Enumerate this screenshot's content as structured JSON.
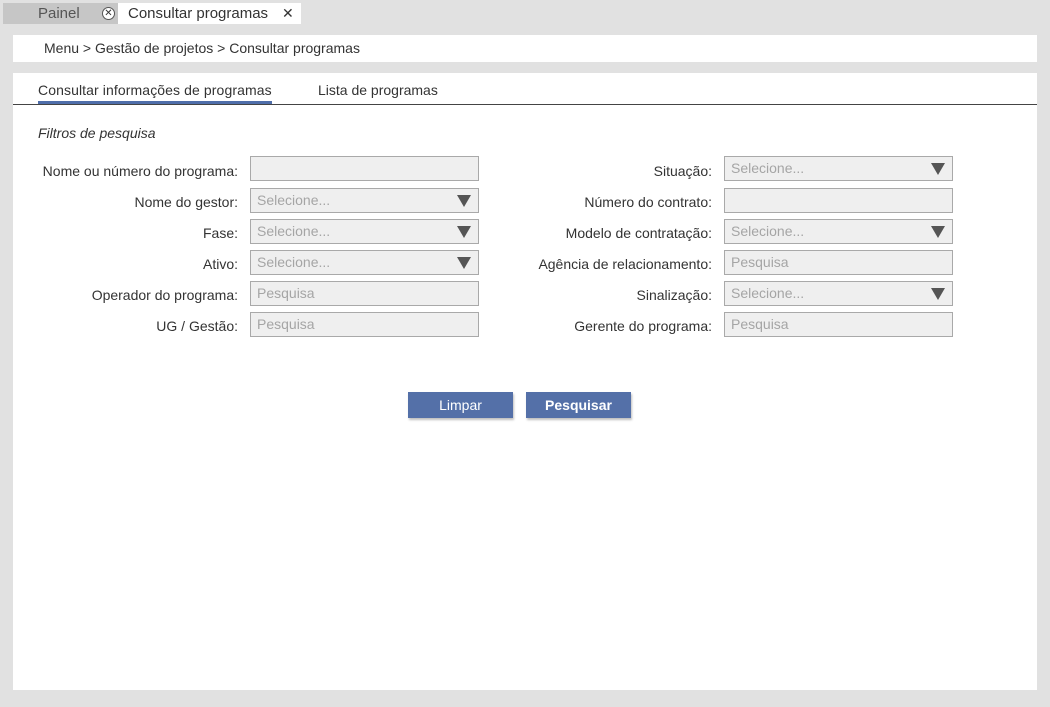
{
  "tabs": [
    {
      "label": "Painel"
    },
    {
      "label": "Consultar programas"
    }
  ],
  "breadcrumb": "Menu > Gestão de projetos > Consultar programas",
  "panel_tabs": {
    "active": "Consultar informações de programas",
    "list": "Lista de programas"
  },
  "section_title": "Filtros de pesquisa",
  "left_fields": [
    {
      "label": "Nome ou número do programa:",
      "value": "",
      "type": "text"
    },
    {
      "label": "Nome do gestor:",
      "value": "Selecione...",
      "type": "select"
    },
    {
      "label": "Fase:",
      "value": "Selecione...",
      "type": "select"
    },
    {
      "label": "Ativo:",
      "value": "Selecione...",
      "type": "select"
    },
    {
      "label": "Operador do programa:",
      "value": "Pesquisa",
      "type": "text"
    },
    {
      "label": "UG / Gestão:",
      "value": "Pesquisa",
      "type": "text"
    }
  ],
  "right_fields": [
    {
      "label": "Situação:",
      "value": "Selecione...",
      "type": "select"
    },
    {
      "label": "Número do contrato:",
      "value": "",
      "type": "text"
    },
    {
      "label": "Modelo de contratação:",
      "value": "Selecione...",
      "type": "select"
    },
    {
      "label": "Agência de relacionamento:",
      "value": "Pesquisa",
      "type": "text"
    },
    {
      "label": "Sinalização:",
      "value": "Selecione...",
      "type": "select"
    },
    {
      "label": "Gerente do programa:",
      "value": "Pesquisa",
      "type": "text"
    }
  ],
  "buttons": {
    "clear": "Limpar",
    "search": "Pesquisar"
  }
}
